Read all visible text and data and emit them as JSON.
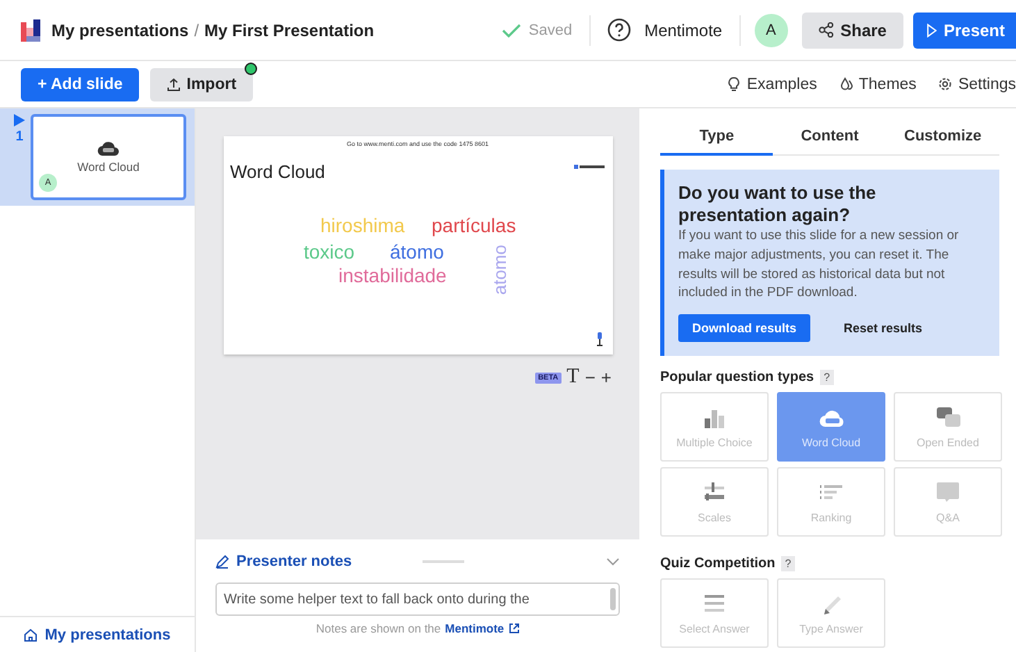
{
  "header": {
    "breadcrumb": [
      {
        "label": "My presentations"
      },
      {
        "label": "My First Presentation"
      }
    ],
    "separator": "/",
    "status": "Saved",
    "help_label": "Mentimote",
    "avatar": "A",
    "share": "Share",
    "present": "Present"
  },
  "toolbar": {
    "add_slide": "+ Add slide",
    "import": "Import",
    "import_badge": true,
    "links": [
      {
        "kind": "examples",
        "label": "Examples"
      },
      {
        "kind": "themes",
        "label": "Themes"
      },
      {
        "kind": "settings",
        "label": "Settings"
      }
    ]
  },
  "slides": [
    {
      "number": "1",
      "label": "Word Cloud",
      "avatar": "A",
      "selected": true
    }
  ],
  "footer_link": "My presentations",
  "slide": {
    "instruction": "Go to www.menti.com and use the code 1475 8601",
    "title": "Word Cloud",
    "words": [
      {
        "text": "hiroshima",
        "color": "#f2c94c",
        "vertical": false
      },
      {
        "text": "partículas",
        "color": "#e0474c",
        "vertical": false
      },
      {
        "text": "toxico",
        "color": "#5cc98a",
        "vertical": false
      },
      {
        "text": "átomo",
        "color": "#3f6fe0",
        "vertical": false
      },
      {
        "text": "instabilidade",
        "color": "#e06b9a",
        "vertical": false
      },
      {
        "text": "atomo",
        "color": "#a9a6ee",
        "vertical": true
      }
    ]
  },
  "zoom_controls": {
    "badge": "BETA",
    "font": "T",
    "minus": "−",
    "plus": "+"
  },
  "notes": {
    "title": "Presenter notes",
    "placeholder": "Write some helper text to fall back onto during the",
    "hint": "Notes are shown on the",
    "hint_link": "Mentimote"
  },
  "panel": {
    "tabs": [
      {
        "label": "Type",
        "selected": true
      },
      {
        "label": "Content",
        "selected": false
      },
      {
        "label": "Customize",
        "selected": false
      }
    ],
    "notice": {
      "title": "Do you want to use the presentation again?",
      "body": "If you want to use this slide for a new session or make major adjustments, you can reset it. The results will be stored as historical data but not included in the PDF download.",
      "primary": "Download results",
      "secondary": "Reset results"
    },
    "sections": [
      {
        "title": "Popular question types",
        "help": "?",
        "types": [
          {
            "kind": "bars",
            "label": "Multiple Choice",
            "selected": false
          },
          {
            "kind": "cloud",
            "label": "Word Cloud",
            "selected": true
          },
          {
            "kind": "bubbles",
            "label": "Open Ended",
            "selected": false
          },
          {
            "kind": "scales",
            "label": "Scales",
            "selected": false
          },
          {
            "kind": "ranking",
            "label": "Ranking",
            "selected": false
          },
          {
            "kind": "qa",
            "label": "Q&A",
            "selected": false
          }
        ]
      },
      {
        "title": "Quiz Competition",
        "help": "?",
        "types": [
          {
            "kind": "lines",
            "label": "Select Answer",
            "selected": false
          },
          {
            "kind": "pencil",
            "label": "Type Answer",
            "selected": false
          }
        ]
      }
    ]
  }
}
